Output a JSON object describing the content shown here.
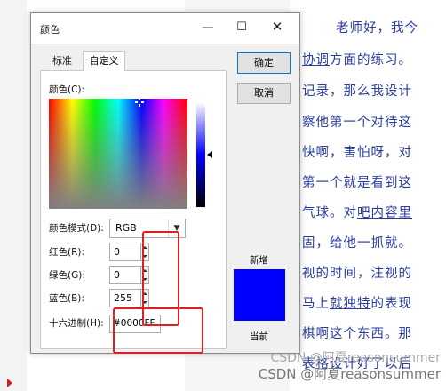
{
  "background_doc": {
    "lines": [
      [
        "老师好，我今"
      ],
      [
        "协调",
        "方面的练习。"
      ],
      [
        "记录，那么我设计"
      ],
      [
        "察他第一个对待这"
      ],
      [
        "快啊，害怕呀，对"
      ],
      [
        "第一个就是看到这"
      ],
      [
        "气球。对",
        "吧内容里"
      ],
      [
        "固，给他一抓就。"
      ],
      [
        "视的时间，注视的"
      ],
      [
        "马上",
        "就独特",
        "的表现"
      ],
      [
        "棋啊这个东西。那"
      ],
      [
        "表格设计好了以后"
      ]
    ],
    "watermark_1": "CSDN @阿夏reasonsummer",
    "watermark_2": "CSDN @阿夏reasonsummer"
  },
  "dialog": {
    "title": "颜色",
    "minimize_glyph": "—",
    "maximize_glyph": "☐",
    "close_glyph": "✕",
    "tabs": [
      "标准",
      "自定义"
    ],
    "active_tab": "自定义",
    "colors_label": "颜色(C):",
    "color_model_label": "颜色模式(D):",
    "color_model_value": "RGB",
    "red_label": "红色(R):",
    "red_value": "0",
    "green_label": "绿色(G):",
    "green_value": "0",
    "blue_label": "蓝色(B):",
    "blue_value": "255",
    "hex_label": "十六进制(H):",
    "hex_value": "#0000FF",
    "ok_label": "确定",
    "cancel_label": "取消",
    "new_label": "新增",
    "current_label": "当前",
    "preview_color": "#0000FF",
    "annotation_color": "#E02020"
  }
}
